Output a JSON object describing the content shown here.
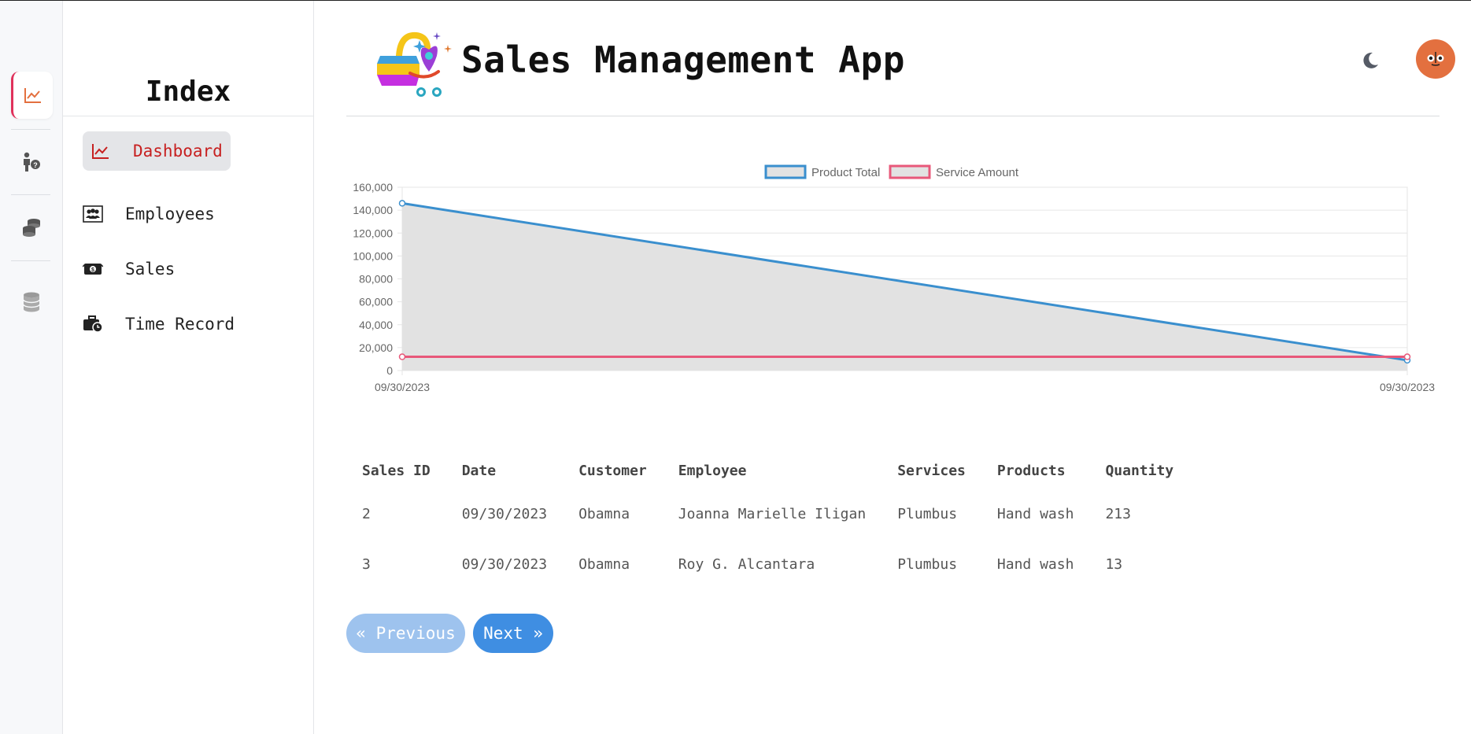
{
  "sidebar": {
    "title": "Index",
    "items": [
      {
        "label": "Dashboard",
        "icon": "chart-line-icon",
        "active": true
      },
      {
        "label": "Employees",
        "icon": "people-icon"
      },
      {
        "label": "Sales",
        "icon": "money-icon"
      },
      {
        "label": "Time Record",
        "icon": "briefcase-clock-icon"
      }
    ]
  },
  "rail": {
    "items": [
      {
        "icon": "chart-line-icon",
        "active": true
      },
      {
        "icon": "person-question-icon"
      },
      {
        "icon": "coins-stack-icon"
      },
      {
        "icon": "database-icon"
      }
    ]
  },
  "header": {
    "title": "Sales Management App"
  },
  "colors": {
    "accent_red": "#c72020",
    "rail_active_border": "#e0315b",
    "product_line": "#3a8fce",
    "service_line": "#e8587a",
    "next_button": "#3f8ee2",
    "prev_button": "#9ec3ee",
    "avatar": "#e3703f"
  },
  "chart_data": {
    "type": "line",
    "x": [
      "09/30/2023",
      "09/30/2023"
    ],
    "series": [
      {
        "name": "Product Total",
        "values": [
          146000,
          9000
        ],
        "color": "#3a8fce"
      },
      {
        "name": "Service Amount",
        "values": [
          12000,
          12000
        ],
        "color": "#e8587a"
      }
    ],
    "ylim": [
      0,
      160000
    ],
    "yticks": [
      "160,000",
      "140,000",
      "120,000",
      "100,000",
      "80,000",
      "60,000",
      "40,000",
      "20,000",
      "0"
    ],
    "xticks": [
      "09/30/2023",
      "09/30/2023"
    ],
    "legend": "top-center",
    "grid": true
  },
  "table": {
    "headers": [
      "Sales ID",
      "Date",
      "Customer",
      "Employee",
      "Services",
      "Products",
      "Quantity"
    ],
    "rows": [
      [
        "2",
        "09/30/2023",
        "Obamna",
        "Joanna Marielle Iligan",
        "Plumbus",
        "Hand wash",
        "213"
      ],
      [
        "3",
        "09/30/2023",
        "Obamna",
        "Roy G. Alcantara",
        "Plumbus",
        "Hand wash",
        "13"
      ]
    ]
  },
  "pagination": {
    "prev_label": "« Previous",
    "next_label": "Next »"
  }
}
